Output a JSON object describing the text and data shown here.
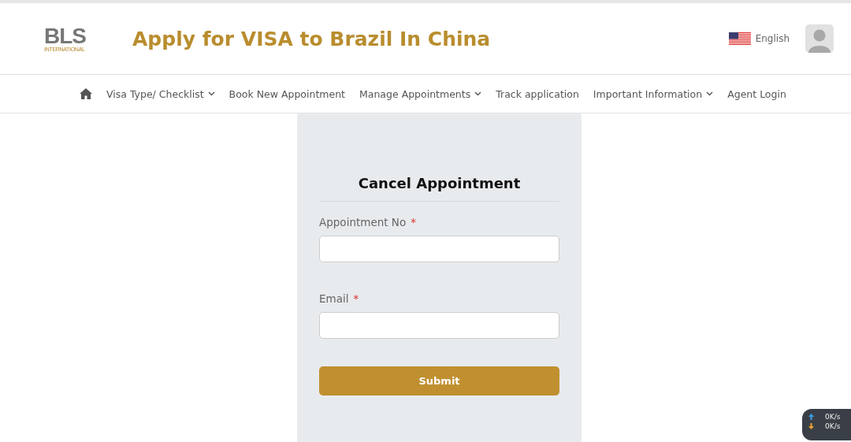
{
  "header": {
    "logo": {
      "name": "BLS",
      "subtitle": "INTERNATIONAL"
    },
    "title": "Apply for VISA to Brazil In China",
    "language": "English"
  },
  "nav": [
    {
      "label": "Visa Type/ Checklist",
      "dropdown": true
    },
    {
      "label": "Book New Appointment",
      "dropdown": false
    },
    {
      "label": "Manage Appointments",
      "dropdown": true
    },
    {
      "label": "Track application",
      "dropdown": false
    },
    {
      "label": "Important Information",
      "dropdown": true
    },
    {
      "label": "Agent Login",
      "dropdown": false
    }
  ],
  "form": {
    "title": "Cancel Appointment",
    "fields": [
      {
        "label": "Appointment No",
        "required_mark": "*"
      },
      {
        "label": "Email",
        "required_mark": "*"
      }
    ],
    "submit": "Submit"
  },
  "speed_widget": {
    "upload": "0K/s",
    "download": "0K/s"
  }
}
